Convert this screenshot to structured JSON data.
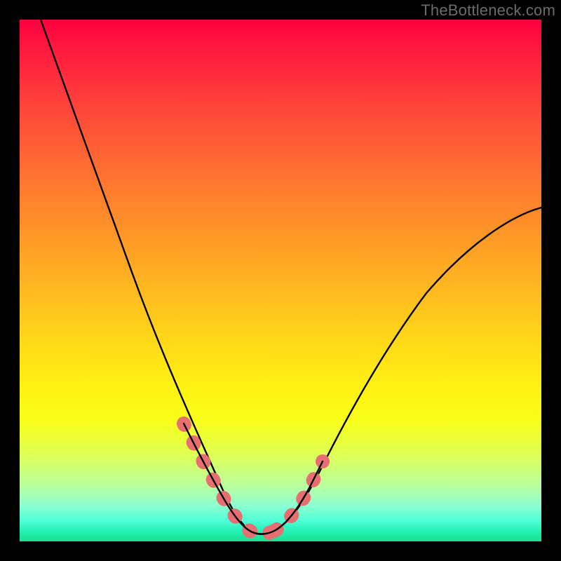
{
  "watermark": "TheBottleneck.com",
  "chart_data": {
    "type": "line",
    "title": "",
    "xlabel": "",
    "ylabel": "",
    "xlim": [
      0,
      100
    ],
    "ylim": [
      0,
      100
    ],
    "grid": false,
    "legend": false,
    "series": [
      {
        "name": "bottleneck-curve",
        "style": "black-line",
        "x": [
          4,
          8,
          12,
          16,
          20,
          24,
          28,
          32,
          36,
          38,
          40,
          42,
          44,
          46,
          48,
          50,
          54,
          58,
          64,
          72,
          80,
          90,
          100
        ],
        "y": [
          100,
          88,
          76,
          65,
          54,
          44,
          34,
          24,
          15,
          10,
          6,
          3,
          1.5,
          1,
          1,
          2,
          5,
          10,
          18,
          30,
          42,
          54,
          63
        ]
      },
      {
        "name": "curve-highlight",
        "style": "pink-thick",
        "x": [
          30,
          32,
          34,
          36,
          38,
          40,
          42,
          44,
          46,
          48,
          50,
          52,
          53,
          54,
          55
        ],
        "y": [
          18,
          14,
          10,
          7,
          4.5,
          2.5,
          1.5,
          1,
          1,
          1.3,
          2.2,
          4,
          5.5,
          7.5,
          9.5
        ]
      }
    ],
    "background_gradient": {
      "direction": "top-to-bottom",
      "stops": [
        {
          "pct": 0,
          "color": "#ff0040"
        },
        {
          "pct": 50,
          "color": "#ffb020"
        },
        {
          "pct": 75,
          "color": "#fff012"
        },
        {
          "pct": 100,
          "color": "#1adf8f"
        }
      ]
    }
  }
}
